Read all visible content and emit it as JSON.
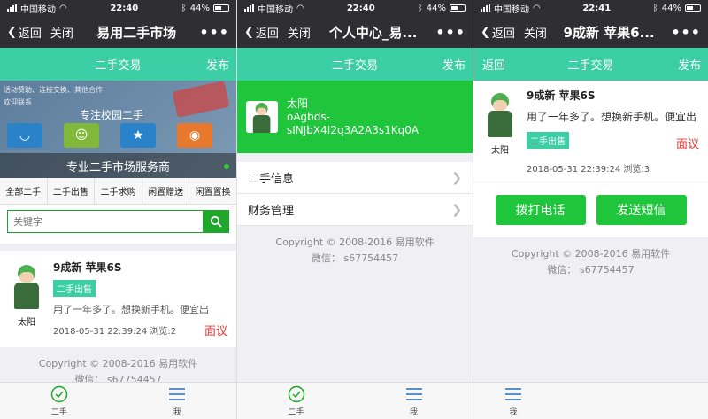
{
  "status": {
    "carrier": "中国移动",
    "battery": "44%",
    "times": [
      "22:40",
      "22:40",
      "22:41"
    ]
  },
  "screen1": {
    "nav": {
      "back": "返回",
      "close": "关闭",
      "title": "易用二手市场",
      "more": "•••"
    },
    "greenbar": {
      "title": "二手交易",
      "right": "发布"
    },
    "banner": {
      "lines": [
        "活动赞助、连接交换、其他合作",
        "欢迎联系"
      ],
      "slogan": "专注校园二手",
      "caption": "专业二手市场服务商"
    },
    "categories": [
      "全部二手",
      "二手出售",
      "二手求购",
      "闲置赠送",
      "闲置置换"
    ],
    "search_placeholder": "关键字",
    "item": {
      "title": "9成新 苹果6S",
      "tag": "二手出售",
      "desc": "用了一年多了。想换新手机。便宜出",
      "time": "2018-05-31 22:39:24",
      "views": "浏览:2",
      "price": "面议",
      "user": "太阳"
    },
    "copyright": [
      "Copyright © 2008-2016 易用软件",
      "微信： s67754457"
    ],
    "tabs": [
      "二手",
      "我"
    ]
  },
  "screen2": {
    "nav": {
      "back": "返回",
      "close": "关闭",
      "title": "个人中心_易...",
      "more": "•••"
    },
    "greenbar": {
      "title": "二手交易",
      "right": "发布"
    },
    "profile": {
      "name": "太阳",
      "id_line1": "oAgbds-",
      "id_line2": "sINJbX4I2q3A2A3s1Kq0A"
    },
    "menu": [
      "二手信息",
      "财务管理"
    ],
    "copyright": [
      "Copyright © 2008-2016 易用软件",
      "微信： s67754457"
    ],
    "tabs": [
      "二手",
      "我"
    ]
  },
  "screen3": {
    "nav": {
      "back": "返回",
      "close": "关闭",
      "title": "9成新 苹果6...",
      "more": "•••"
    },
    "greenbar": {
      "left": "返回",
      "title": "二手交易",
      "right": "发布"
    },
    "item": {
      "title": "9成新 苹果6S",
      "desc": "用了一年多了。想换新手机。便宜出",
      "tag": "二手出售",
      "price": "面议",
      "time": "2018-05-31 22:39:24",
      "views": "浏览:3",
      "user": "太阳"
    },
    "buttons": {
      "call": "拨打电话",
      "sms": "发送短信"
    },
    "copyright": [
      "Copyright © 2008-2016 易用软件",
      "微信： s67754457"
    ],
    "tabs": [
      "我"
    ]
  },
  "colors": {
    "nav": "#2e2e33",
    "accent": "#3ccfa6",
    "green": "#1fc63b",
    "price": "#ee3333"
  }
}
